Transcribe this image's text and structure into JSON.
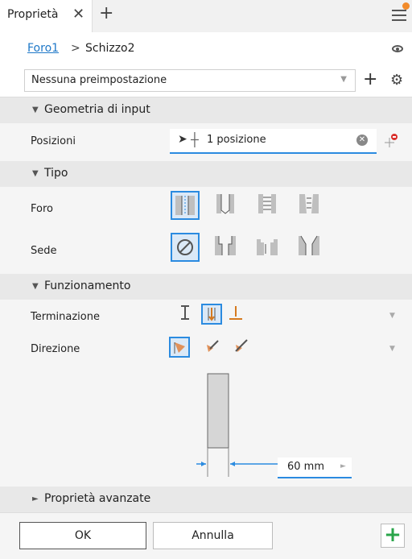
{
  "tabs": {
    "active_label": "Proprietà",
    "close_glyph": "✕",
    "add_glyph": "+"
  },
  "breadcrumb": {
    "item1": "Foro1",
    "separator": ">",
    "item2": "Schizzo2"
  },
  "preset": {
    "value": "Nessuna preimpostazione"
  },
  "sections": {
    "geometry": "Geometria di input",
    "type": "Tipo",
    "behavior": "Funzionamento",
    "advanced": "Proprietà avanzate"
  },
  "fields": {
    "positions_label": "Posizioni",
    "positions_value": "1 posizione",
    "hole_label": "Foro",
    "seat_label": "Sede",
    "termination_label": "Terminazione",
    "direction_label": "Direzione"
  },
  "dimension": {
    "value": "60 mm"
  },
  "buttons": {
    "ok": "OK",
    "cancel": "Annulla"
  },
  "colors": {
    "accent": "#2b8be0",
    "link": "#1e78c8",
    "add_green": "#2aa54a",
    "orange": "#f28b2a"
  },
  "icons": [
    "close-icon",
    "plus-icon",
    "menu-icon",
    "eye-icon",
    "gear-icon",
    "cursor-icon",
    "crosshair-icon",
    "clear-icon",
    "pin-icon"
  ]
}
